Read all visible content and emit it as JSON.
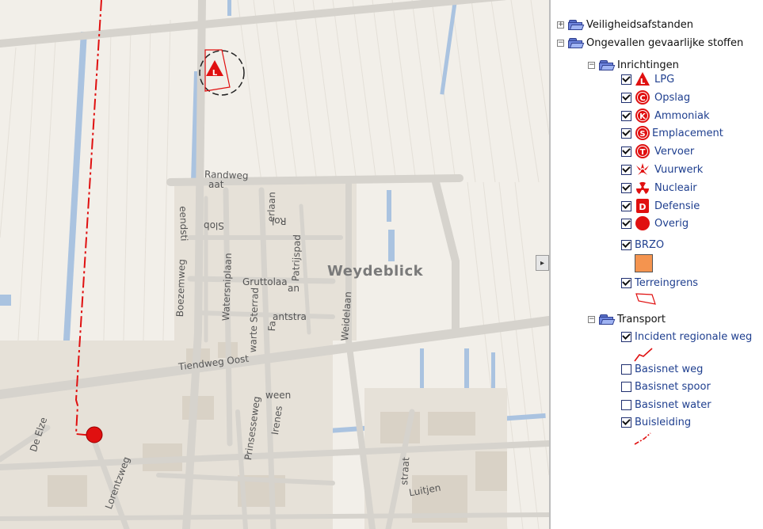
{
  "map": {
    "streets": {
      "randweg": "Randweg",
      "aat": "aat",
      "eendstraat": "eendsti",
      "erlaan": "erlaan",
      "slob": "Slob",
      "rol": "Rol",
      "patrijspad": "Patrijspad",
      "boezemweg": "Boezemweg",
      "watersniplaan": "Watersniplaan",
      "gruttolaan": "Gruttolaa",
      "an": "an",
      "sternstraat": "warte Sterrad",
      "fa": "Fa",
      "antstr": "antstra",
      "weidelaan": "Weidelaan",
      "tiendweg": "Tiendweg Oost",
      "prinsesseweg": "Prinsesseweg",
      "irenes": "Irenes",
      "ween": "ween",
      "de_elzen": "De Elze",
      "lorentzweg": "Lorentzweg",
      "straat": "straat",
      "luitjens": "Luitjen"
    },
    "place_name": "Weydeblick",
    "colors": {
      "background": "#f2efe9",
      "road": "#d9d6d0",
      "water": "#aac3e0",
      "pipeline": "#e01010",
      "incident": "#e01010"
    }
  },
  "collapse_handle": {
    "icon": "chevron-right-icon",
    "glyph": "▸"
  },
  "legend": {
    "groups": [
      {
        "label": "Veiligheidsafstanden",
        "expanded": false,
        "expander": "+"
      },
      {
        "label": "Ongevallen gevaarlijke stoffen",
        "expanded": true,
        "expander": "−"
      }
    ],
    "inrichtingen": {
      "label": "Inrichtingen",
      "expander": "−",
      "layers": [
        {
          "label": "LPG",
          "checked": true,
          "icon": "lpg-icon",
          "letter": "L"
        },
        {
          "label": "Opslag",
          "checked": true,
          "icon": "opslag-icon",
          "letter": "C"
        },
        {
          "label": "Ammoniak",
          "checked": true,
          "icon": "ammoniak-icon",
          "letter": "K"
        },
        {
          "label": "Emplacement",
          "checked": true,
          "icon": "emplacement-icon",
          "letter": "S"
        },
        {
          "label": "Vervoer",
          "checked": true,
          "icon": "vervoer-icon",
          "letter": "T"
        },
        {
          "label": "Vuurwerk",
          "checked": true,
          "icon": "vuurwerk-icon"
        },
        {
          "label": "Nucleair",
          "checked": true,
          "icon": "nucleair-icon"
        },
        {
          "label": "Defensie",
          "checked": true,
          "icon": "defensie-icon",
          "letter": "D"
        },
        {
          "label": "Overig",
          "checked": true,
          "icon": "overig-icon"
        }
      ],
      "brzo": {
        "label": "BRZO",
        "checked": true,
        "color": "#f4944f"
      },
      "terreingrens": {
        "label": "Terreingrens",
        "checked": true,
        "color": "#e01010"
      }
    },
    "transport": {
      "label": "Transport",
      "expander": "−",
      "layers": [
        {
          "label": "Incident regionale weg",
          "checked": true
        },
        {
          "label": "Basisnet weg",
          "checked": false
        },
        {
          "label": "Basisnet spoor",
          "checked": false
        },
        {
          "label": "Basisnet water",
          "checked": false
        },
        {
          "label": "Buisleiding",
          "checked": true
        }
      ]
    },
    "accent_color": "#e01010",
    "link_color": "#1f3f8f"
  }
}
